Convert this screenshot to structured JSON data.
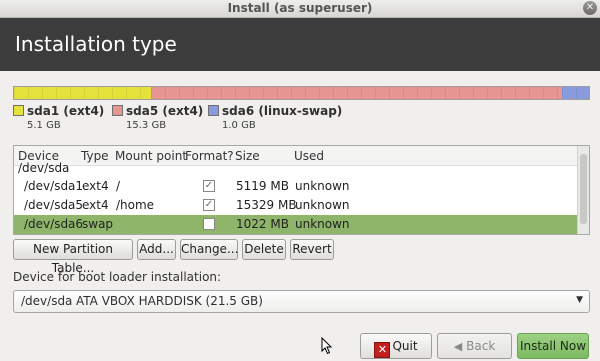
{
  "window": {
    "title": "Install (as superuser)"
  },
  "header": {
    "title": "Installation type"
  },
  "disk_bar": {
    "segments": [
      {
        "name": "sda1",
        "color": "#e5e33b",
        "gb": 5.1
      },
      {
        "name": "sda5",
        "color": "#e79593",
        "gb": 15.3
      },
      {
        "name": "sda6",
        "color": "#8a9bdd",
        "gb": 1.0
      }
    ]
  },
  "legend": [
    {
      "name": "sda1 (ext4)",
      "size": "5.1 GB",
      "color": "#e5e33b"
    },
    {
      "name": "sda5 (ext4)",
      "size": "15.3 GB",
      "color": "#e79593"
    },
    {
      "name": "sda6 (linux-swap)",
      "size": "1.0 GB",
      "color": "#8a9bdd"
    }
  ],
  "table": {
    "columns": [
      "Device",
      "Type",
      "Mount point",
      "Format?",
      "Size",
      "Used"
    ],
    "group_label": "/dev/sda",
    "rows": [
      {
        "device": "/dev/sda1",
        "type": "ext4",
        "mount": "/",
        "format": true,
        "size": "5119 MB",
        "used": "unknown",
        "selected": false
      },
      {
        "device": "/dev/sda5",
        "type": "ext4",
        "mount": "/home",
        "format": true,
        "size": "15329 MB",
        "used": "unknown",
        "selected": false
      },
      {
        "device": "/dev/sda6",
        "type": "swap",
        "mount": "",
        "format": false,
        "size": "1022 MB",
        "used": "unknown",
        "selected": true
      }
    ]
  },
  "table_buttons": {
    "new_table": "New Partition Table...",
    "add": "Add...",
    "change": "Change...",
    "delete": "Delete",
    "revert": "Revert"
  },
  "bootloader": {
    "label": "Device for boot loader installation:",
    "device": "/dev/sda",
    "description": "ATA VBOX HARDDISK (21.5 GB)"
  },
  "footer": {
    "quit": "Quit",
    "back": "Back",
    "install": "Install Now"
  },
  "colors": {
    "header_bg": "#3c3c3c",
    "selected_row": "#8fb56b",
    "install_button": "#8cc472"
  }
}
